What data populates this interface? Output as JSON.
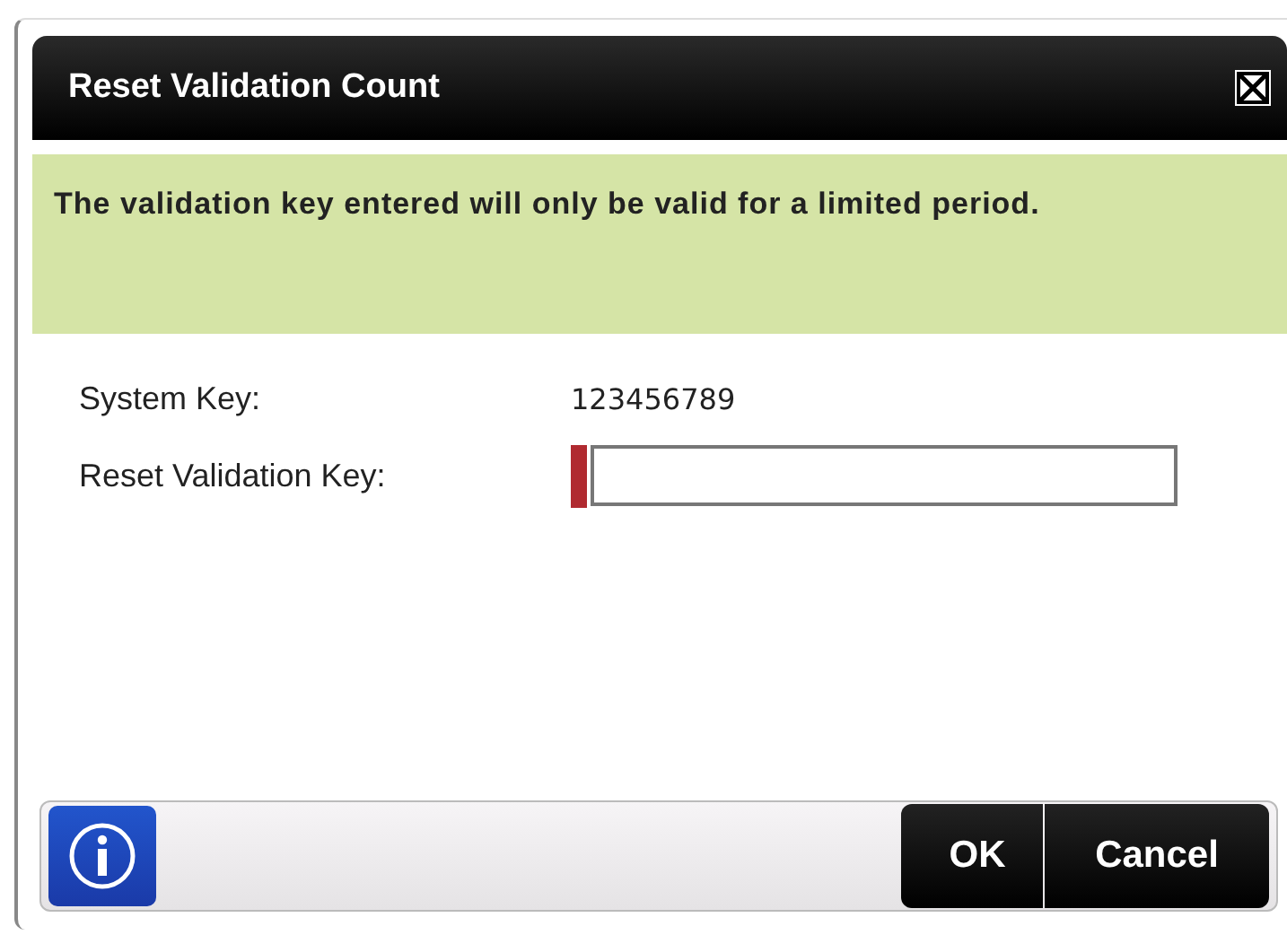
{
  "dialog": {
    "title": "Reset Validation Count"
  },
  "message": "The validation key entered will only be valid for a limited period.",
  "fields": [
    {
      "kind": "text",
      "label": "System Key:",
      "value": "123456789"
    },
    {
      "kind": "input",
      "label": "Reset Validation Key:",
      "required": true
    }
  ],
  "buttons": [
    "OK",
    "Cancel"
  ]
}
